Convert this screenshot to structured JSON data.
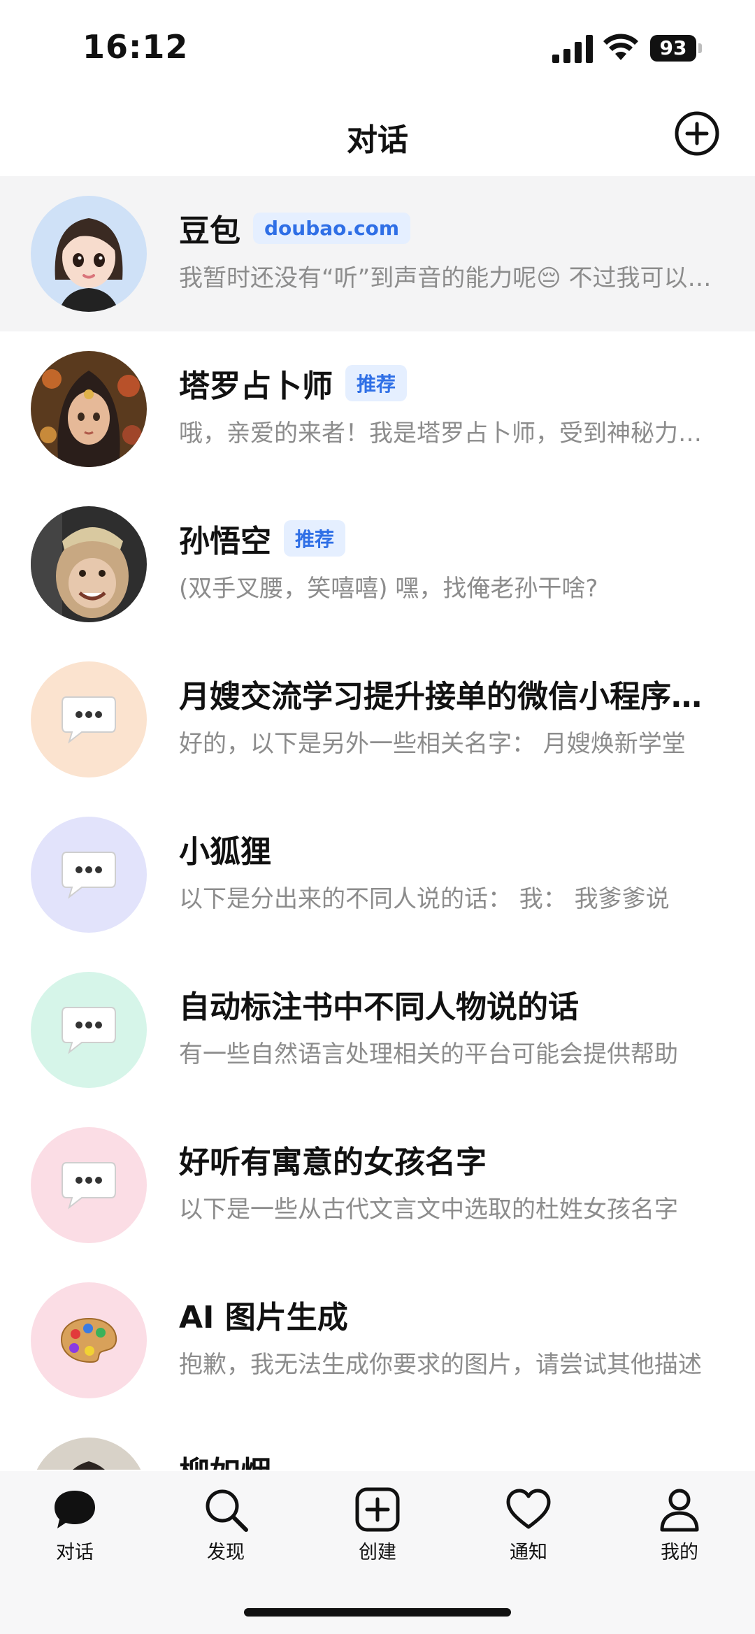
{
  "status_bar": {
    "time": "16:12",
    "battery": "93"
  },
  "header": {
    "title": "对话"
  },
  "chats": [
    {
      "name": "豆包",
      "tag": "doubao.com",
      "preview": "我暂时还没有“听”到声音的能力呢😔 不过我可以通过文字和你交流",
      "avatar": "doubao-avatar"
    },
    {
      "name": "塔罗占卜师",
      "tag": "推荐",
      "preview": "哦，亲爱的来者！我是塔罗占卜师，受到神秘力量的指引",
      "avatar": "tarot-avatar"
    },
    {
      "name": "孙悟空",
      "tag": "推荐",
      "preview": "(双手叉腰，笑嘻嘻) 嘿，找俺老孙干啥?",
      "avatar": "wukong-avatar"
    },
    {
      "name": "月嫂交流学习提升接单的微信小程序名字",
      "tag": "",
      "preview": "好的，以下是另外一些相关名字： 月嫂焕新学堂",
      "avatar": "chat-bubble-icon",
      "avatar_bg": "#fbe3cf"
    },
    {
      "name": "小狐狸",
      "tag": "",
      "preview": "以下是分出来的不同人说的话： 我： 我爹爹说",
      "avatar": "chat-bubble-icon",
      "avatar_bg": "#e2e3fb"
    },
    {
      "name": "自动标注书中不同人物说的话",
      "tag": "",
      "preview": "有一些自然语言处理相关的平台可能会提供帮助",
      "avatar": "chat-bubble-icon",
      "avatar_bg": "#d6f5e9"
    },
    {
      "name": "好听有寓意的女孩名字",
      "tag": "",
      "preview": "以下是一些从古代文言文中选取的杜姓女孩名字",
      "avatar": "chat-bubble-icon",
      "avatar_bg": "#fbdde5"
    },
    {
      "name": "AI 图片生成",
      "tag": "",
      "preview": "抱歉，我无法生成你要求的图片，请尝试其他描述",
      "avatar": "palette-icon",
      "avatar_bg": "#fbdde5"
    },
    {
      "name": "柳如烟",
      "tag": "",
      "preview": "",
      "avatar": "liuruyan-avatar"
    }
  ],
  "tabs": [
    {
      "label": "对话",
      "icon": "chat-icon"
    },
    {
      "label": "发现",
      "icon": "search-icon"
    },
    {
      "label": "创建",
      "icon": "create-icon"
    },
    {
      "label": "通知",
      "icon": "heart-icon"
    },
    {
      "label": "我的",
      "icon": "profile-icon"
    }
  ],
  "colors": {
    "tag_bg": "#e5efff",
    "tag_text": "#2f6fe6",
    "preview_text": "#8c8c8c",
    "active_row": "#f4f4f5"
  }
}
